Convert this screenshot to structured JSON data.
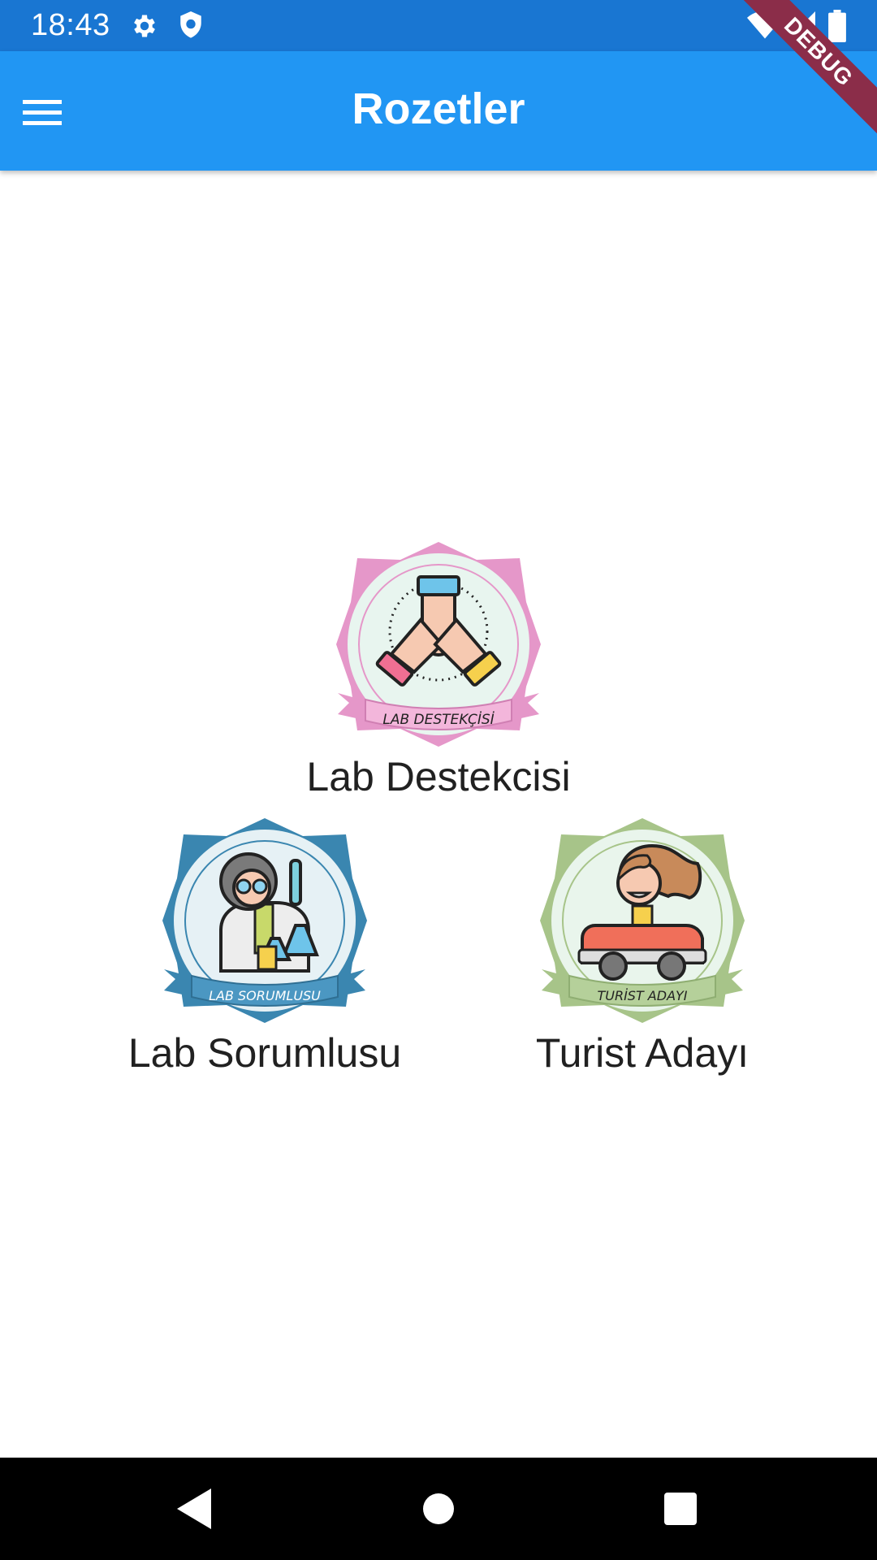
{
  "status_bar": {
    "time": "18:43",
    "icons": [
      "settings-icon",
      "shield-icon",
      "wifi-icon",
      "signal-icon",
      "battery-icon"
    ]
  },
  "app_bar": {
    "title": "Rozetler",
    "menu_icon": "hamburger-menu-icon",
    "color": "#2196f3",
    "status_color": "#1976d2"
  },
  "debug_banner": {
    "label": "DEBUG",
    "color": "#8b2d49"
  },
  "badges": [
    {
      "name": "Lab Destekcisi",
      "ribbon_text": "LAB DESTEKÇİSİ",
      "color": "#e597c9",
      "inner": "#e8f5ef",
      "icon": "hands-together-icon"
    },
    {
      "name": "Lab Sorumlusu",
      "ribbon_text": "LAB SORUMLUSU",
      "color": "#3a86b0",
      "inner": "#e6f1f5",
      "icon": "scientist-icon"
    },
    {
      "name": "Turist Adayı",
      "ribbon_text": "TURİST ADAYI",
      "color": "#a7c489",
      "inner": "#e9f5ec",
      "icon": "girl-in-car-icon"
    }
  ],
  "nav_bar": {
    "icons": [
      "back-icon",
      "home-icon",
      "recents-icon"
    ]
  }
}
